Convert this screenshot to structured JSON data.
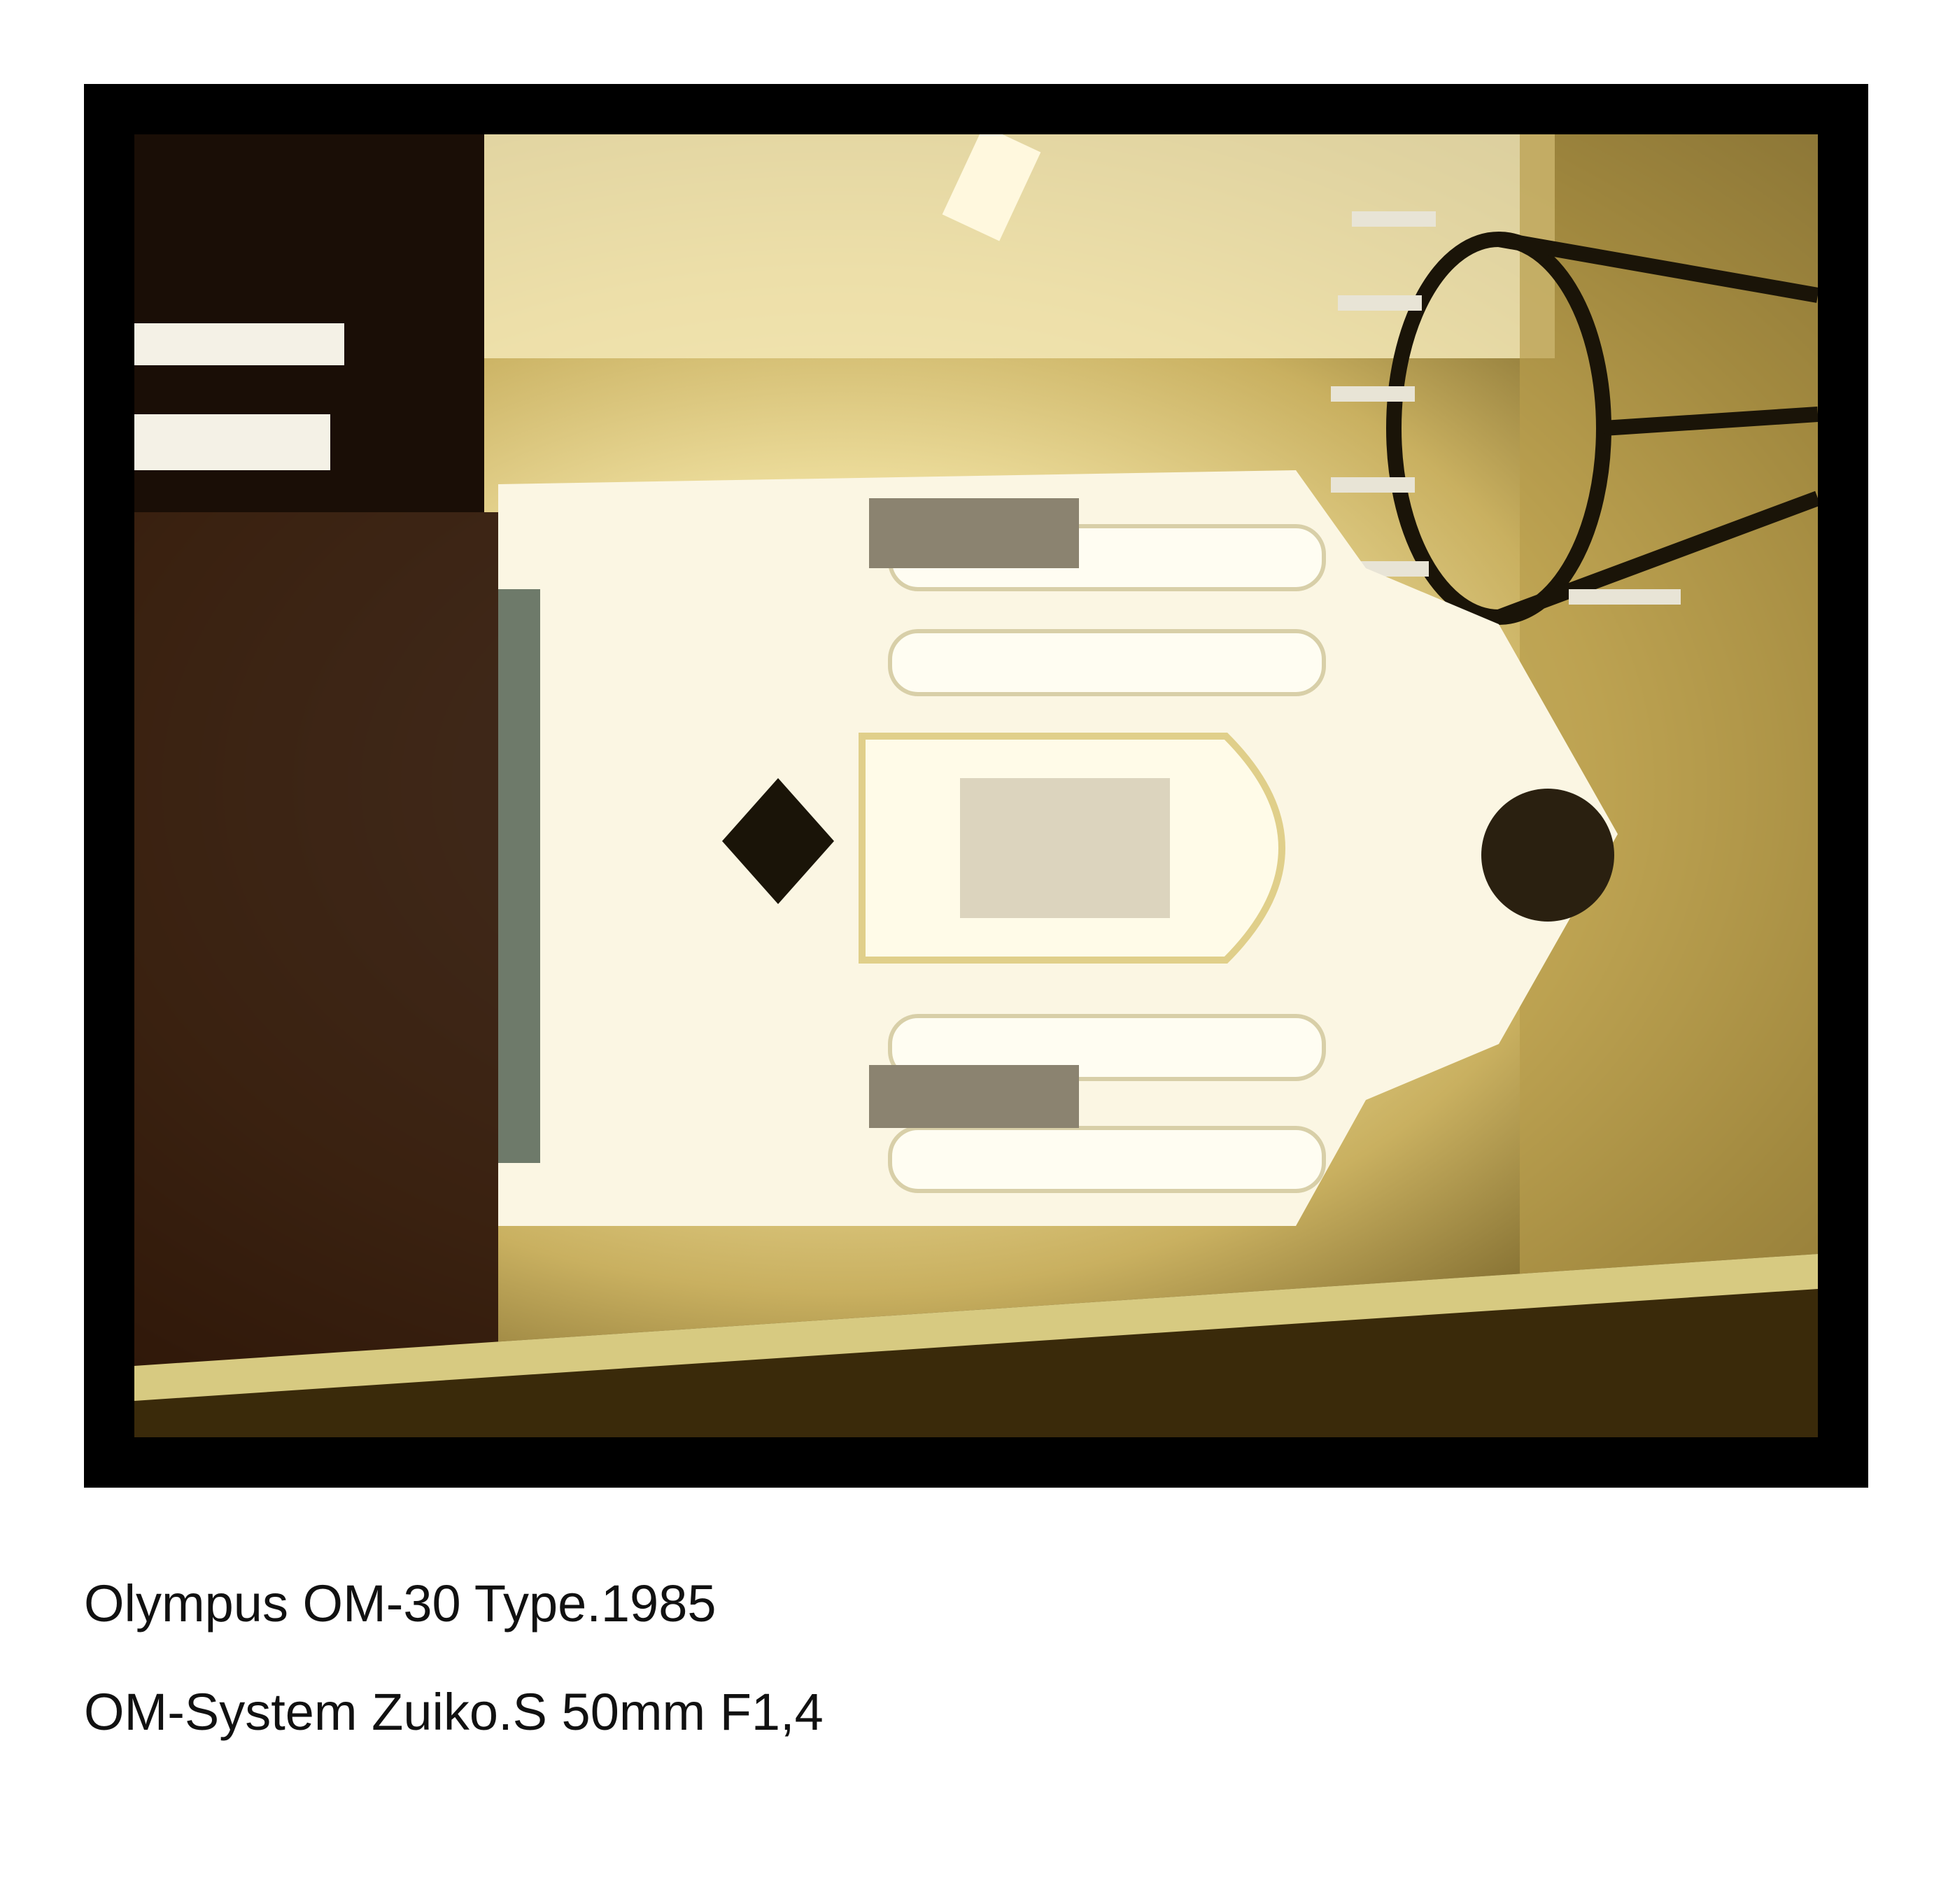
{
  "photo": {
    "subject": "altar-interior-photograph",
    "colors": {
      "frame": "#000000",
      "highlight": "#fbf3cf",
      "tone": "#c9b060",
      "shadow": "#2a2008"
    }
  },
  "captions": {
    "camera": "Olympus OM-30 Type.1985",
    "lens": "OM-System Zuiko.S 50mm F1,4"
  }
}
